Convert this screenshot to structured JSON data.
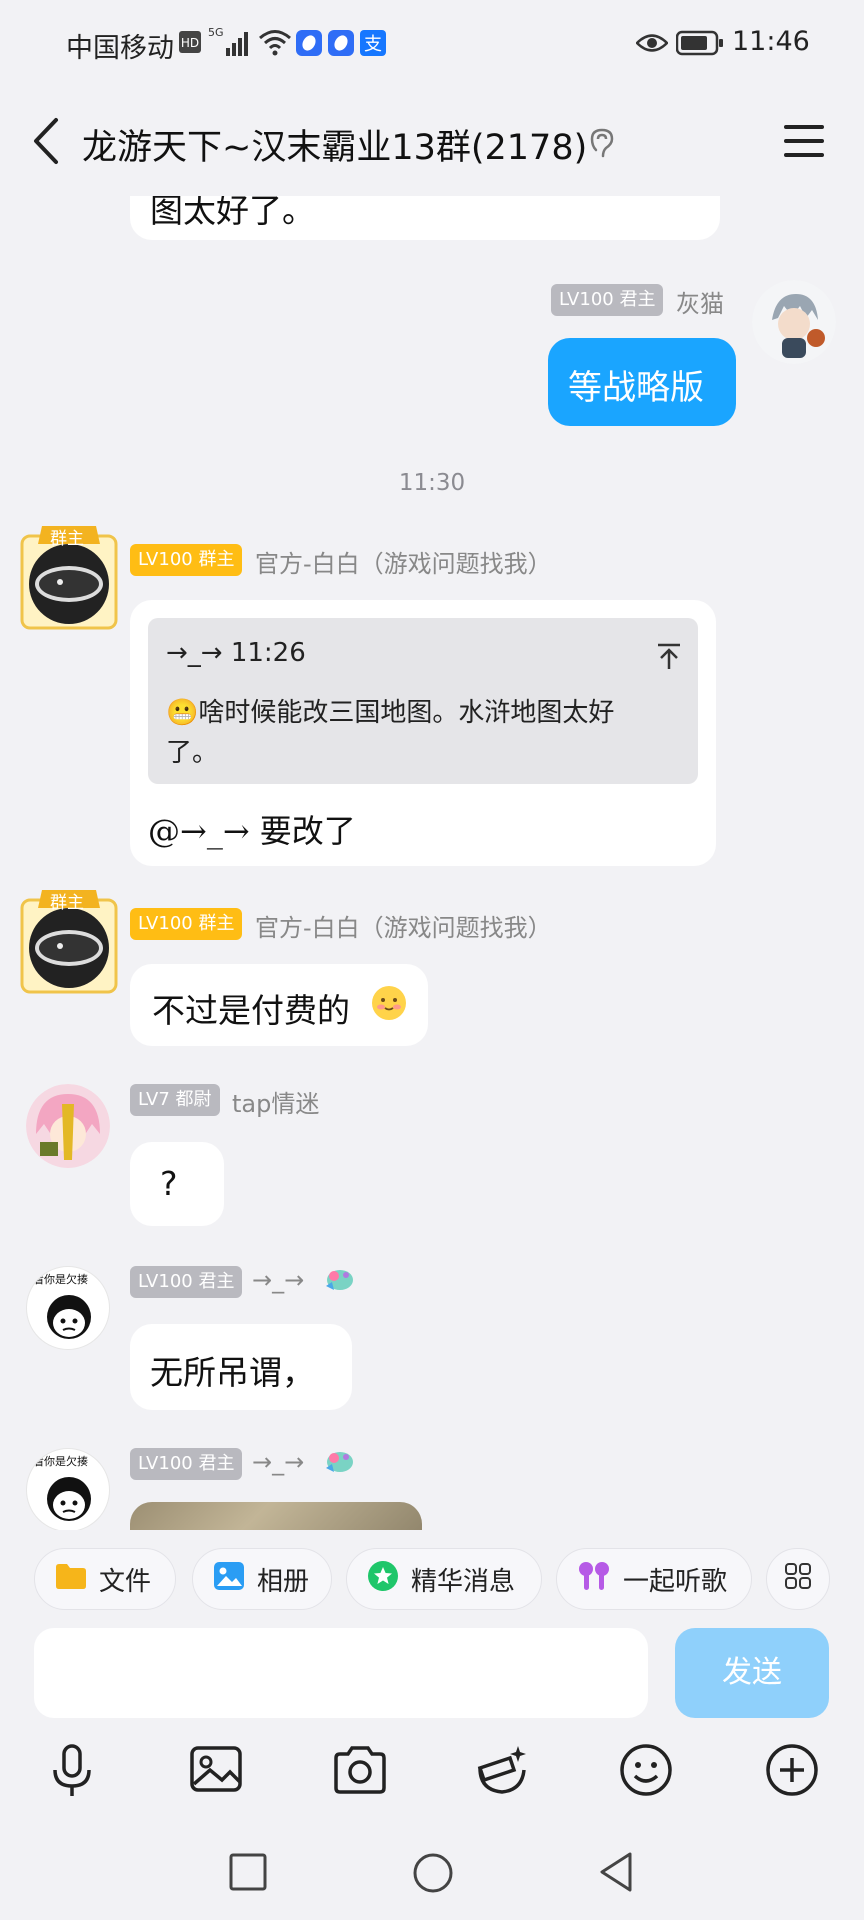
{
  "status_bar": {
    "carrier": "中国移动",
    "network": "5G",
    "time": "11:46"
  },
  "header": {
    "title": "龙游天下~汉末霸业13群(2178)"
  },
  "messages": {
    "prev_tail_text": "图太好了。",
    "m1": {
      "badge": "LV100 君主",
      "nick": "灰猫",
      "text": "等战略版"
    },
    "timestamp": "11:30",
    "m2": {
      "avatar_tag": "群主",
      "badge": "LV100 群主",
      "nick": "官方-白白（游戏问题找我）",
      "quote_header": "→_→ 11:26",
      "quote_text_line1": "😬啥时候能改三国地图。水浒地图太好",
      "quote_text_line2": "了。",
      "reply_text": "@→_→ 要改了"
    },
    "m3": {
      "avatar_tag": "群主",
      "badge": "LV100 群主",
      "nick": "官方-白白（游戏问题找我）",
      "text": "不过是付费的"
    },
    "m4": {
      "badge": "LV7 都尉",
      "nick": "tap情迷",
      "text": "?"
    },
    "m5": {
      "avatar_caption": "看你是欠揍",
      "badge": "LV100 君主",
      "nick": "→_→",
      "text": "无所吊谓，"
    },
    "m6": {
      "avatar_caption": "看你是欠揍",
      "badge": "LV100 君主",
      "nick": "→_→"
    }
  },
  "quick_actions": [
    {
      "label": "文件",
      "icon": "folder-icon"
    },
    {
      "label": "相册",
      "icon": "album-icon"
    },
    {
      "label": "精华消息",
      "icon": "essence-icon"
    },
    {
      "label": "一起听歌",
      "icon": "earbuds-icon"
    }
  ],
  "input": {
    "placeholder": "",
    "send_label": "发送"
  },
  "colors": {
    "accent_blue": "#1aa5ff",
    "gold_badge": "#ffbd14",
    "gray_badge": "#b9b9bf",
    "background": "#f2f2f5"
  }
}
